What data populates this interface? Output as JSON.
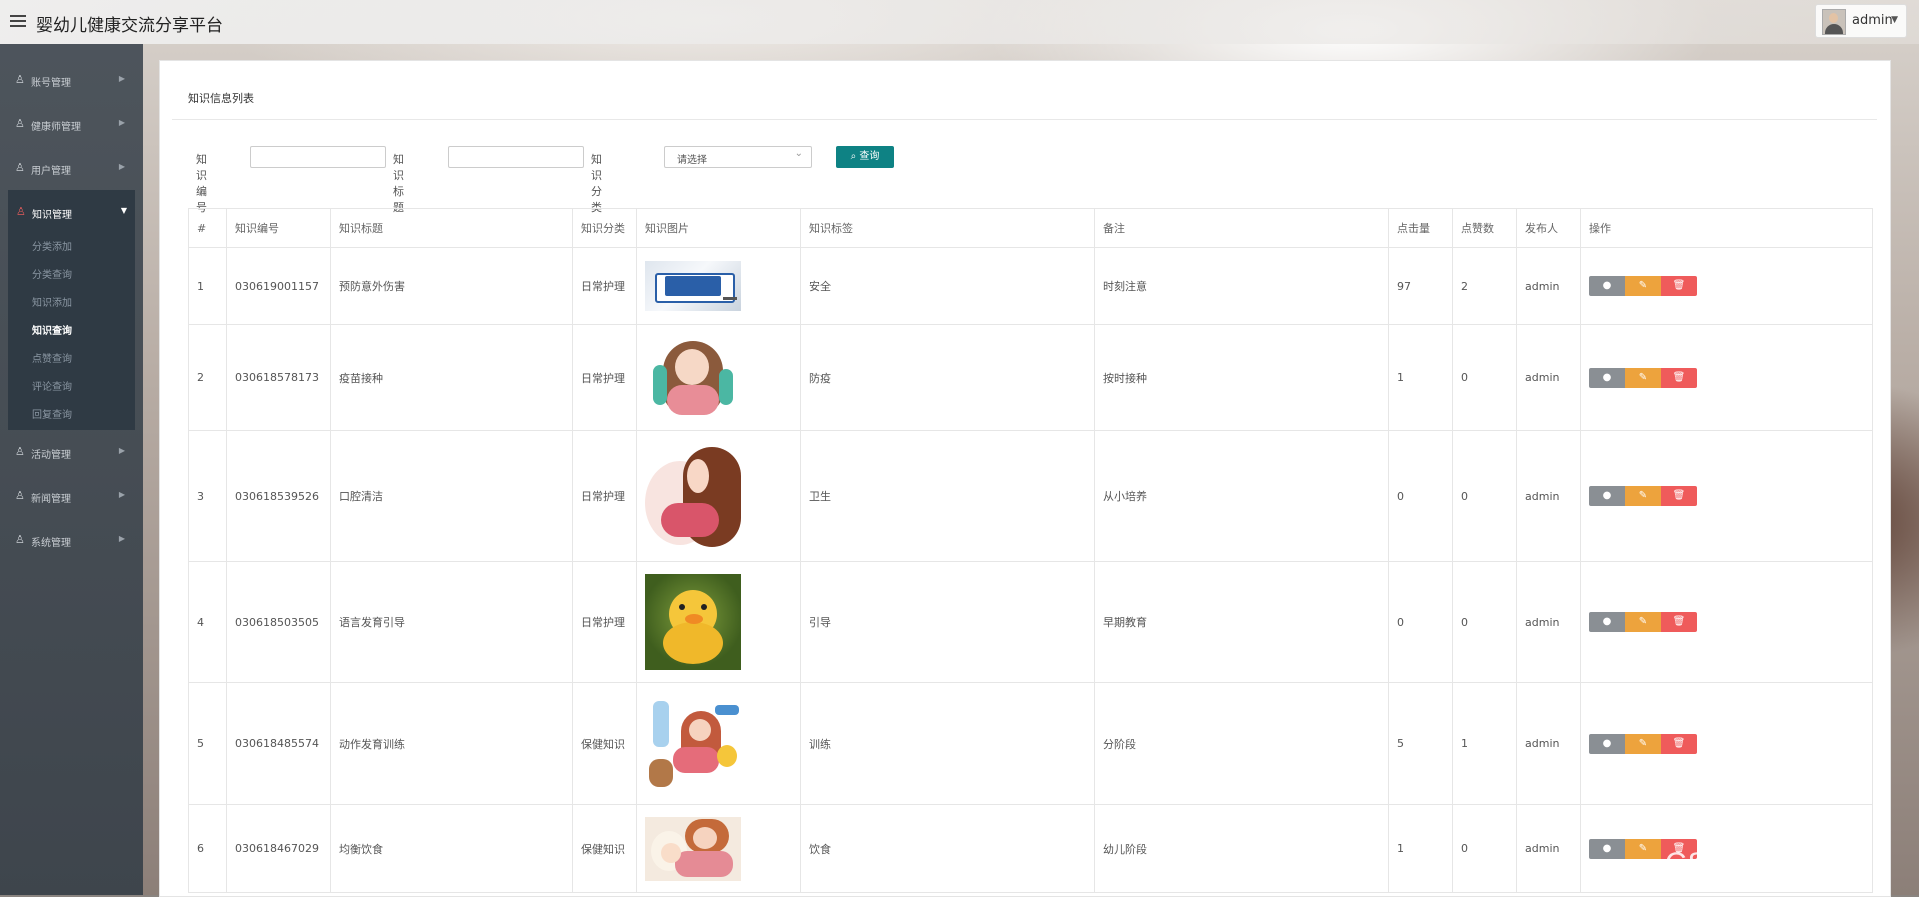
{
  "app": {
    "title": "婴幼儿健康交流分享平台",
    "user": "admin"
  },
  "sidebar": {
    "items": [
      {
        "label": "账号管理"
      },
      {
        "label": "健康师管理"
      },
      {
        "label": "用户管理"
      },
      {
        "label": "知识管理",
        "children": [
          "分类添加",
          "分类查询",
          "知识添加",
          "知识查询",
          "点赞查询",
          "评论查询",
          "回复查询"
        ]
      },
      {
        "label": "活动管理"
      },
      {
        "label": "新闻管理"
      },
      {
        "label": "系统管理"
      }
    ]
  },
  "panel": {
    "title": "知识信息列表"
  },
  "search": {
    "id_label": "知识编号",
    "title_label": "知识标题",
    "category_label": "知识分类",
    "category_value": "请选择",
    "button_label": "查询"
  },
  "table": {
    "headers": [
      "#",
      "知识编号",
      "知识标题",
      "知识分类",
      "知识图片",
      "知识标签",
      "备注",
      "点击量",
      "点赞数",
      "发布人",
      "操作"
    ],
    "rows": [
      {
        "no": "1",
        "id": "030619001157",
        "title": "预防意外伤害",
        "category": "日常护理",
        "image": "muying-logo",
        "tag": "安全",
        "note": "时刻注意",
        "clicks": "97",
        "likes": "2",
        "author": "admin"
      },
      {
        "no": "2",
        "id": "030618578173",
        "title": "疫苗接种",
        "category": "日常护理",
        "image": "mother-baby-illustration",
        "tag": "防疫",
        "note": "按时接种",
        "clicks": "1",
        "likes": "0",
        "author": "admin"
      },
      {
        "no": "3",
        "id": "030618539526",
        "title": "口腔清洁",
        "category": "日常护理",
        "image": "mother-holding-baby-illustration",
        "tag": "卫生",
        "note": "从小培养",
        "clicks": "0",
        "likes": "0",
        "author": "admin"
      },
      {
        "no": "4",
        "id": "030618503505",
        "title": "语言发育引导",
        "category": "日常护理",
        "image": "duckling-photo",
        "tag": "引导",
        "note": "早期教育",
        "clicks": "0",
        "likes": "0",
        "author": "admin"
      },
      {
        "no": "5",
        "id": "030618485574",
        "title": "动作发育训练",
        "category": "保健知识",
        "image": "mother-child-toys-illustration",
        "tag": "训练",
        "note": "分阶段",
        "clicks": "5",
        "likes": "1",
        "author": "admin"
      },
      {
        "no": "6",
        "id": "030618467029",
        "title": "均衡饮食",
        "category": "保健知识",
        "image": "mother-sleeping-baby-illustration",
        "tag": "饮食",
        "note": "幼儿阶段",
        "clicks": "1",
        "likes": "0",
        "author": "admin"
      }
    ]
  },
  "watermark": "CSDN @汤姆yu",
  "colors": {
    "search_button": "#0e8284",
    "view": "#8a8f94",
    "edit": "#eda33d",
    "delete": "#ef5b5b",
    "sidebar": "#46505a"
  }
}
